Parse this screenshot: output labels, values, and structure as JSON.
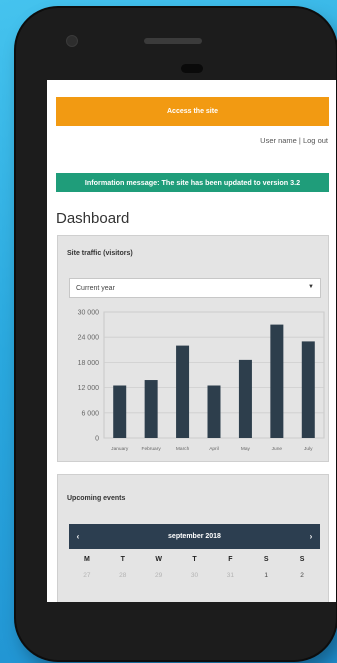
{
  "header": {
    "access_label": "Access the site"
  },
  "user": {
    "username": "User name",
    "separator": " | ",
    "logout": "Log out"
  },
  "info_message": "Information message: The site has been updated to version 3.2",
  "page_title": "Dashboard",
  "traffic": {
    "title": "Site traffic (visitors)",
    "period_select": {
      "selected": "Current year"
    }
  },
  "chart_data": {
    "type": "bar",
    "categories": [
      "January",
      "February",
      "March",
      "April",
      "May",
      "June",
      "July"
    ],
    "values": [
      12500,
      13800,
      22000,
      12500,
      18600,
      27000,
      23000
    ],
    "ylim": [
      0,
      30000
    ],
    "yticks": [
      "30 000",
      "24 000",
      "18 000",
      "12 000",
      "6 000",
      "0"
    ],
    "grid": true,
    "color": "#2d3e4c"
  },
  "events": {
    "title": "Upcoming events",
    "calendar": {
      "month_label": "september 2018",
      "prev": "‹",
      "next": "›",
      "weekdays": [
        "M",
        "T",
        "W",
        "T",
        "F",
        "S",
        "S"
      ],
      "row1": [
        "27",
        "28",
        "29",
        "30",
        "31",
        "1",
        "2"
      ]
    }
  },
  "colors": {
    "accent_orange": "#f29a12",
    "info_green": "#1f9d7a",
    "calendar_header": "#2c3e50"
  }
}
